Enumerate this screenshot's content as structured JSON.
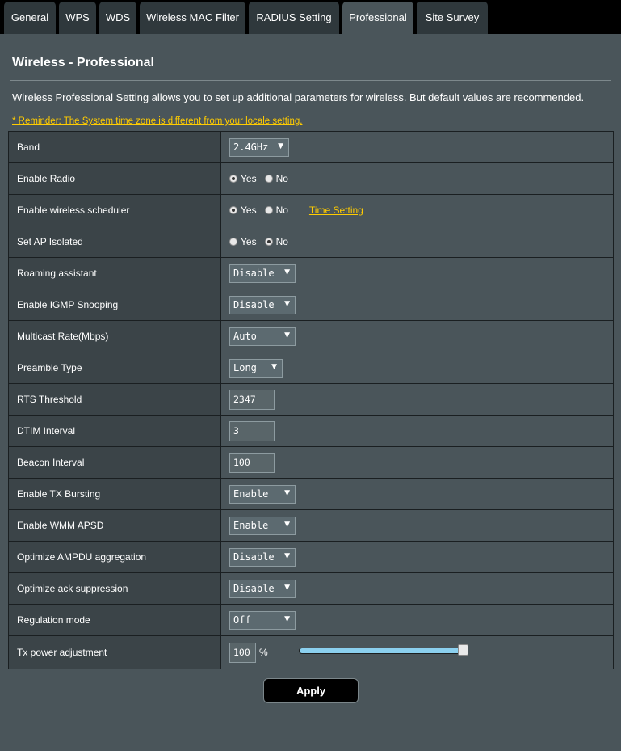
{
  "tabs": [
    "General",
    "WPS",
    "WDS",
    "Wireless MAC Filter",
    "RADIUS Setting",
    "Professional",
    "Site Survey"
  ],
  "page": {
    "title": "Wireless - Professional",
    "description": "Wireless Professional Setting allows you to set up additional parameters for wireless. But default values are recommended.",
    "reminder": "* Reminder: The System time zone is different from your locale setting."
  },
  "rows": {
    "band": {
      "label": "Band",
      "value": "2.4GHz"
    },
    "enable_radio": {
      "label": "Enable Radio",
      "yes": "Yes",
      "no": "No",
      "selected": "Yes"
    },
    "scheduler": {
      "label": "Enable wireless scheduler",
      "yes": "Yes",
      "no": "No",
      "selected": "Yes",
      "link": "Time Setting"
    },
    "ap_isolated": {
      "label": "Set AP Isolated",
      "yes": "Yes",
      "no": "No",
      "selected": "No"
    },
    "roaming": {
      "label": "Roaming assistant",
      "value": "Disable"
    },
    "igmp": {
      "label": "Enable IGMP Snooping",
      "value": "Disable"
    },
    "multicast": {
      "label": "Multicast Rate(Mbps)",
      "value": "Auto"
    },
    "preamble": {
      "label": "Preamble Type",
      "value": "Long"
    },
    "rts": {
      "label": "RTS Threshold",
      "value": "2347"
    },
    "dtim": {
      "label": "DTIM Interval",
      "value": "3"
    },
    "beacon": {
      "label": "Beacon Interval",
      "value": "100"
    },
    "tx_bursting": {
      "label": "Enable TX Bursting",
      "value": "Enable"
    },
    "wmm_apsd": {
      "label": "Enable WMM APSD",
      "value": "Enable"
    },
    "ampdu": {
      "label": "Optimize AMPDU aggregation",
      "value": "Disable"
    },
    "ack": {
      "label": "Optimize ack suppression",
      "value": "Disable"
    },
    "regulation": {
      "label": "Regulation mode",
      "value": "Off"
    },
    "tx_power": {
      "label": "Tx power adjustment",
      "value": "100",
      "unit": "%",
      "slider_percent": 100
    }
  },
  "apply_label": "Apply",
  "colors": {
    "accent": "#ffcc00",
    "slider": "#8bd0ef",
    "background": "#4a555a",
    "label_bg": "#3b4448"
  }
}
